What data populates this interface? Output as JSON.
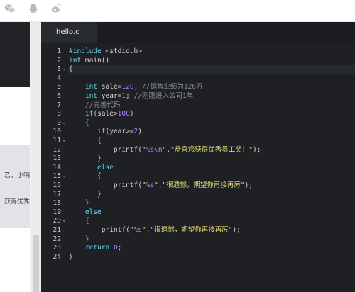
{
  "toolbar": {
    "icons": [
      "wechat-icon",
      "qq-icon",
      "weibo-icon"
    ]
  },
  "left_page": {
    "fragment_1": "乙，小明",
    "fragment_2": "获得优秀"
  },
  "editor": {
    "tab_label": "hello.c",
    "colors": {
      "background": "#1e2023",
      "keyword": "#66d9ef",
      "number": "#ae81ff",
      "string": "#e6db74",
      "comment": "#8c9298"
    },
    "lines": [
      {
        "num": "1",
        "fold": "",
        "text": "#include <stdio.h>"
      },
      {
        "num": "2",
        "fold": "",
        "text": "int main()"
      },
      {
        "num": "3",
        "fold": "▾",
        "text": "{"
      },
      {
        "num": "4",
        "fold": "",
        "text": ""
      },
      {
        "num": "5",
        "fold": "",
        "text": "    int sale=120; //销售业绩为120万"
      },
      {
        "num": "6",
        "fold": "",
        "text": "    int year=1; //刚刚进入公司1年"
      },
      {
        "num": "7",
        "fold": "",
        "text": "    //完善代码"
      },
      {
        "num": "8",
        "fold": "",
        "text": "    if(sale>100)"
      },
      {
        "num": "9",
        "fold": "▾",
        "text": "    {"
      },
      {
        "num": "10",
        "fold": "",
        "text": "       if(year>=2)"
      },
      {
        "num": "11",
        "fold": "▾",
        "text": "       {"
      },
      {
        "num": "12",
        "fold": "",
        "text": "           printf(\"%s\\n\",\"恭喜您获得优秀员工奖！\");"
      },
      {
        "num": "13",
        "fold": "",
        "text": "       }"
      },
      {
        "num": "14",
        "fold": "",
        "text": "       else"
      },
      {
        "num": "15",
        "fold": "▾",
        "text": "       {"
      },
      {
        "num": "16",
        "fold": "",
        "text": "           printf(\"%s\",\"很遗憾，期望你再接再厉\");"
      },
      {
        "num": "17",
        "fold": "",
        "text": "       }"
      },
      {
        "num": "18",
        "fold": "",
        "text": "    }"
      },
      {
        "num": "19",
        "fold": "",
        "text": "    else"
      },
      {
        "num": "20",
        "fold": "▾",
        "text": "    {"
      },
      {
        "num": "21",
        "fold": "",
        "text": "        printf(\"%s\",\"很遗憾，期望你再接再厉\");"
      },
      {
        "num": "22",
        "fold": "",
        "text": "    }"
      },
      {
        "num": "23",
        "fold": "",
        "text": "    return 0;"
      },
      {
        "num": "24",
        "fold": "",
        "text": "}"
      }
    ]
  }
}
